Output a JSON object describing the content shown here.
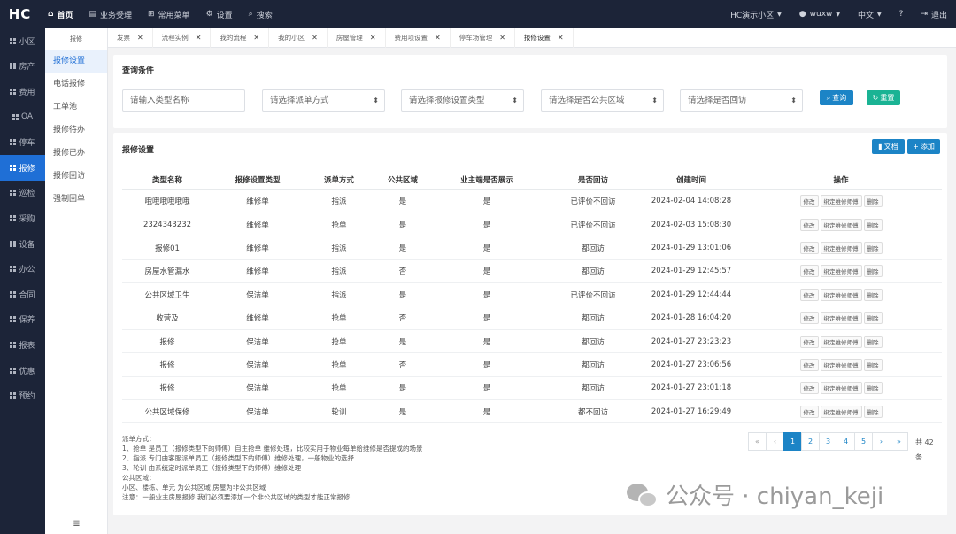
{
  "topbar": {
    "logo": "HC",
    "nav": [
      {
        "label": "首页",
        "icon": "home-icon",
        "active": true
      },
      {
        "label": "业务受理",
        "icon": "form-icon"
      },
      {
        "label": "常用菜单",
        "icon": "sitemap-icon"
      },
      {
        "label": "设置",
        "icon": "gear-icon"
      },
      {
        "label": "搜索",
        "icon": "search-icon"
      }
    ],
    "community": "HC演示小区",
    "user": "wuxw",
    "language": "中文",
    "help": "?",
    "logout": "退出"
  },
  "sidebar": [
    {
      "label": "小区"
    },
    {
      "label": "房产"
    },
    {
      "label": "费用"
    },
    {
      "label": "OA"
    },
    {
      "label": "停车"
    },
    {
      "label": "报修",
      "active": true
    },
    {
      "label": "巡检"
    },
    {
      "label": "采购"
    },
    {
      "label": "设备"
    },
    {
      "label": "办公"
    },
    {
      "label": "合同"
    },
    {
      "label": "保养"
    },
    {
      "label": "报表"
    },
    {
      "label": "优惠"
    },
    {
      "label": "预约"
    }
  ],
  "submenu": {
    "title": "报修",
    "items": [
      "报修设置",
      "电话报修",
      "工单池",
      "报修待办",
      "报修已办",
      "报修回访",
      "强制回单"
    ],
    "active_index": 0,
    "bottom_icon": "≣"
  },
  "tabs": [
    "发票",
    "流程实例",
    "我的流程",
    "我的小区",
    "房屋管理",
    "费用项设置",
    "停车场管理",
    "报修设置"
  ],
  "query": {
    "title": "查询条件",
    "type_name_placeholder": "请输入类型名称",
    "dispatch_select": "请选择派单方式",
    "setting_type_select": "请选择报修设置类型",
    "public_area_select": "请选择是否公共区域",
    "return_visit_select": "请选择是否回访",
    "search_button": "查询",
    "reset_button": "重置"
  },
  "list": {
    "title": "报修设置",
    "doc_button": "文档",
    "add_button": "添加",
    "columns": [
      "类型名称",
      "报修设置类型",
      "派单方式",
      "公共区域",
      "业主端是否展示",
      "是否回访",
      "创建时间",
      "操作"
    ],
    "row_actions": [
      "修改",
      "绑定维修师傅",
      "删除"
    ],
    "rows": [
      [
        "哦哦哦哦哦哦",
        "维修单",
        "指派",
        "是",
        "是",
        "已评价不回访",
        "2024-02-04 14:08:28"
      ],
      [
        "2324343232",
        "维修单",
        "抢单",
        "是",
        "是",
        "已评价不回访",
        "2024-02-03 15:08:30"
      ],
      [
        "报修01",
        "维修单",
        "指派",
        "是",
        "是",
        "都回访",
        "2024-01-29 13:01:06"
      ],
      [
        "房屋水管漏水",
        "维修单",
        "指派",
        "否",
        "是",
        "都回访",
        "2024-01-29 12:45:57"
      ],
      [
        "公共区域卫生",
        "保洁单",
        "指派",
        "是",
        "是",
        "已评价不回访",
        "2024-01-29 12:44:44"
      ],
      [
        "收营及",
        "维修单",
        "抢单",
        "否",
        "是",
        "都回访",
        "2024-01-28 16:04:20"
      ],
      [
        "报修",
        "保洁单",
        "抢单",
        "是",
        "是",
        "都回访",
        "2024-01-27 23:23:23"
      ],
      [
        "报修",
        "保洁单",
        "抢单",
        "否",
        "是",
        "都回访",
        "2024-01-27 23:06:56"
      ],
      [
        "报修",
        "保洁单",
        "抢单",
        "是",
        "是",
        "都回访",
        "2024-01-27 23:01:18"
      ],
      [
        "公共区域保修",
        "保洁单",
        "轮训",
        "是",
        "是",
        "都不回访",
        "2024-01-27 16:29:49"
      ]
    ]
  },
  "notes": [
    "派单方式：",
    "1、抢单 是员工（报修类型下的师傅）自主抢单 维修处理，比较实用于物业每单给维修是否提成的场景",
    "2、指派 专门由客服派单员工（报修类型下的师傅）维修处理，一般物业的选择",
    "3、轮训 由系统定时派单员工（报修类型下的师傅）维修处理",
    "公共区域：",
    "小区、楼栋、单元 为公共区域 房屋为非公共区域",
    "注意：一般业主房屋报修 我们必须要添加一个非公共区域的类型才能正常报修"
  ],
  "pagination": {
    "first": "«",
    "prev": "‹",
    "pages": [
      "1",
      "2",
      "3",
      "4",
      "5"
    ],
    "current": "1",
    "next": "›",
    "last": "»",
    "total_text": "共 42 条"
  },
  "watermark": "公众号 · chiyan_keji"
}
